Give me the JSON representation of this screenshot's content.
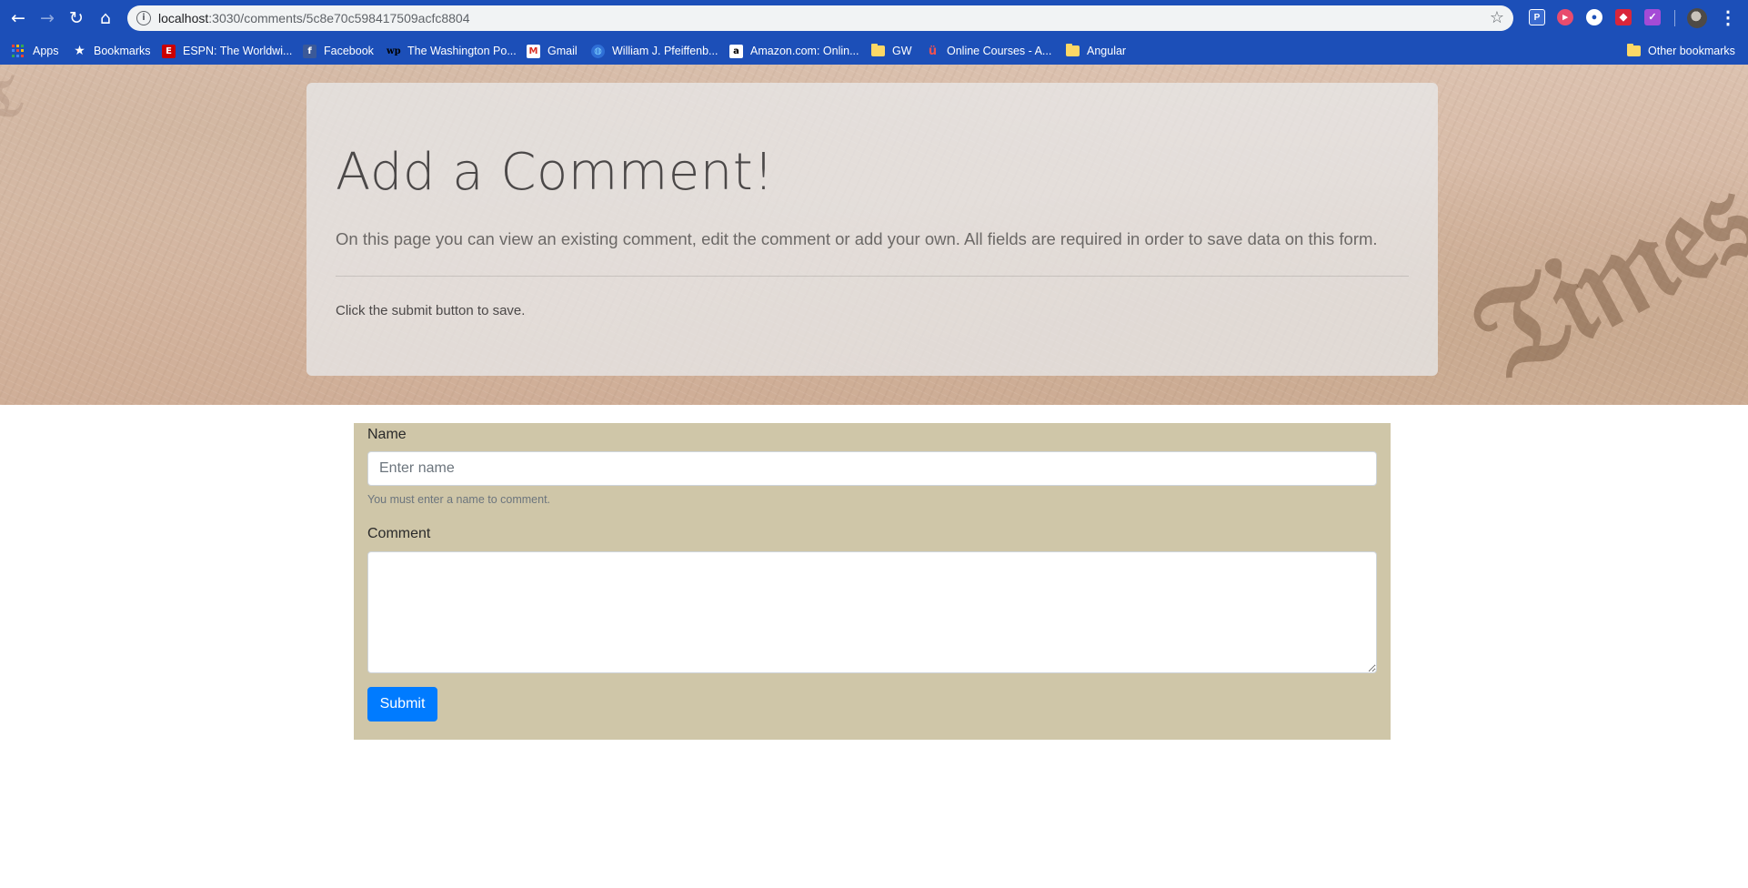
{
  "browser": {
    "url_host": "localhost",
    "url_rest": ":3030/comments/5c8e70c598417509acfc8804",
    "back_icon": "←",
    "forward_icon": "→",
    "reload_icon": "↻",
    "home_icon": "⌂",
    "info_icon": "i",
    "star_icon": "☆",
    "menu_icon": "⋮"
  },
  "bookmarks": {
    "apps": "Apps",
    "items": [
      {
        "label": "Bookmarks",
        "icon": "star-icon"
      },
      {
        "label": "ESPN: The Worldwi...",
        "icon": "espn-icon"
      },
      {
        "label": "Facebook",
        "icon": "facebook-icon"
      },
      {
        "label": "The Washington Po...",
        "icon": "washington-post-icon"
      },
      {
        "label": "Gmail",
        "icon": "gmail-icon"
      },
      {
        "label": "William J. Pfeiffenb...",
        "icon": "globe-icon"
      },
      {
        "label": "Amazon.com: Onlin...",
        "icon": "amazon-icon"
      },
      {
        "label": "GW",
        "icon": "folder-icon"
      },
      {
        "label": "Online Courses - A...",
        "icon": "udemy-icon"
      },
      {
        "label": "Angular",
        "icon": "folder-icon"
      }
    ],
    "other": "Other bookmarks"
  },
  "jumbotron": {
    "title": "Add a Comment!",
    "lead": "On this page you can view an existing comment, edit the comment or add your own. All fields are required in order to save data on this form.",
    "note": "Click the submit button to save."
  },
  "form": {
    "name_label": "Name",
    "name_placeholder": "Enter name",
    "name_value": "",
    "name_help": "You must enter a name to comment.",
    "comment_label": "Comment",
    "comment_value": "",
    "submit_label": "Submit"
  },
  "colors": {
    "chrome": "#1c4fb8",
    "form_panel": "#cfc6a8",
    "primary": "#007bff"
  }
}
